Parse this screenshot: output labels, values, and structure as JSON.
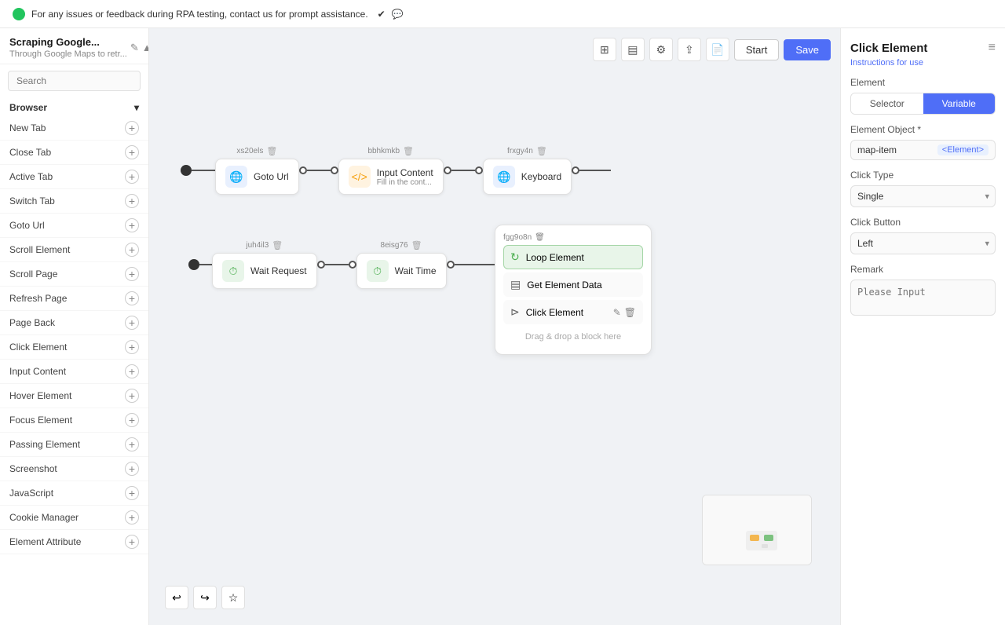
{
  "banner": {
    "text": "For any issues or feedback during RPA testing, contact us for prompt assistance."
  },
  "sidebar": {
    "project_title": "Scraping Google...",
    "project_subtitle": "Through Google Maps to retr...",
    "search_placeholder": "Search",
    "section_label": "Browser",
    "items": [
      {
        "label": "New Tab"
      },
      {
        "label": "Close Tab"
      },
      {
        "label": "Active Tab"
      },
      {
        "label": "Switch Tab"
      },
      {
        "label": "Goto Url"
      },
      {
        "label": "Scroll Element"
      },
      {
        "label": "Scroll Page"
      },
      {
        "label": "Refresh Page"
      },
      {
        "label": "Page Back"
      },
      {
        "label": "Click Element"
      },
      {
        "label": "Input Content"
      },
      {
        "label": "Hover Element"
      },
      {
        "label": "Focus Element"
      },
      {
        "label": "Passing Element"
      },
      {
        "label": "Screenshot"
      },
      {
        "label": "JavaScript"
      },
      {
        "label": "Cookie Manager"
      },
      {
        "label": "Element Attribute"
      }
    ]
  },
  "canvas": {
    "start_btn": "Start",
    "save_btn": "Save",
    "nodes_row1": [
      {
        "id": "xs20els",
        "label": "Goto Url",
        "type": "blue"
      },
      {
        "id": "bbhkmkb",
        "label": "Input Content",
        "sublabel": "Fill in the cont...",
        "type": "orange"
      },
      {
        "id": "frxgy4n",
        "label": "Keyboard",
        "type": "blue"
      }
    ],
    "nodes_row2": [
      {
        "id": "juh4il3",
        "label": "Wait Request",
        "type": "green"
      },
      {
        "id": "8eisg76",
        "label": "Wait Time",
        "type": "green"
      }
    ],
    "loop_group": {
      "id": "fgg9o8n",
      "items": [
        {
          "label": "Loop Element",
          "type": "active"
        },
        {
          "label": "Get Element Data",
          "type": "normal"
        },
        {
          "label": "Click Element",
          "type": "normal"
        }
      ],
      "drag_hint": "Drag & drop a block here"
    }
  },
  "right_panel": {
    "title": "Click Element",
    "instructions_link": "Instructions for use",
    "element_label": "Element",
    "selector_btn": "Selector",
    "variable_btn": "Variable",
    "element_object_label": "Element Object *",
    "element_object_value": "map-item",
    "element_object_tag": "<Element>",
    "click_type_label": "Click Type",
    "click_type_value": "Single",
    "click_button_label": "Click Button",
    "click_button_value": "Left",
    "remark_label": "Remark",
    "remark_placeholder": "Please Input"
  }
}
